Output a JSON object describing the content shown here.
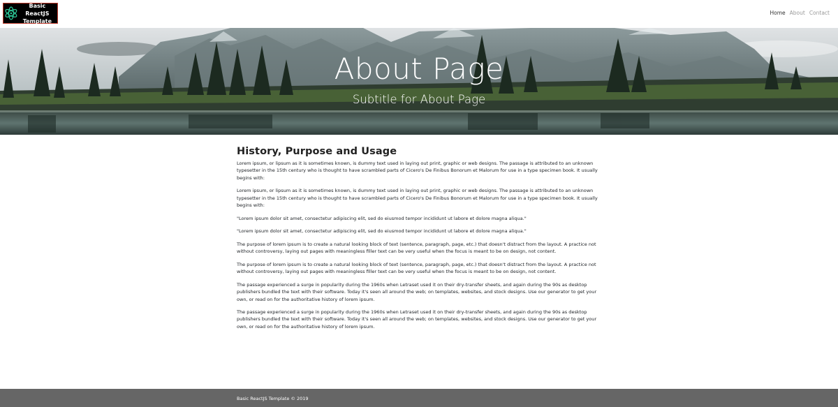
{
  "navbar": {
    "brand_text": "Basic ReactJS Template",
    "links": [
      {
        "label": "Home",
        "active": true
      },
      {
        "label": "About",
        "active": false
      },
      {
        "label": "Contact",
        "active": false
      }
    ]
  },
  "hero": {
    "title": "About Page",
    "subtitle": "Subtitle for About Page"
  },
  "content": {
    "heading": "History, Purpose and Usage",
    "paragraphs": [
      "Lorem ipsum, or lipsum as it is sometimes known, is dummy text used in laying out print, graphic or web designs. The passage is attributed to an unknown typesetter in the 15th century who is thought to have scrambled parts of Cicero's De Finibus Bonorum et Malorum for use in a type specimen book. It usually begins with:",
      "Lorem ipsum, or lipsum as it is sometimes known, is dummy text used in laying out print, graphic or web designs. The passage is attributed to an unknown typesetter in the 15th century who is thought to have scrambled parts of Cicero's De Finibus Bonorum et Malorum for use in a type specimen book. It usually begins with:",
      "\"Lorem ipsum dolor sit amet, consectetur adipiscing elit, sed do eiusmod tempor incididunt ut labore et dolore magna aliqua.\"",
      "\"Lorem ipsum dolor sit amet, consectetur adipiscing elit, sed do eiusmod tempor incididunt ut labore et dolore magna aliqua.\"",
      "The purpose of lorem ipsum is to create a natural looking block of text (sentence, paragraph, page, etc.) that doesn't distract from the layout. A practice not without controversy, laying out pages with meaningless filler text can be very useful when the focus is meant to be on design, not content.",
      "The purpose of lorem ipsum is to create a natural looking block of text (sentence, paragraph, page, etc.) that doesn't distract from the layout. A practice not without controversy, laying out pages with meaningless filler text can be very useful when the focus is meant to be on design, not content.",
      "The passage experienced a surge in popularity during the 1960s when Letraset used it on their dry-transfer sheets, and again during the 90s as desktop publishers bundled the text with their software. Today it's seen all around the web; on templates, websites, and stock designs. Use our generator to get your own, or read on for the authoritative history of lorem ipsum.",
      "The passage experienced a surge in popularity during the 1960s when Letraset used it on their dry-transfer sheets, and again during the 90s as desktop publishers bundled the text with their software. Today it's seen all around the web; on templates, websites, and stock designs. Use our generator to get your own, or read on for the authoritative history of lorem ipsum."
    ]
  },
  "footer": {
    "text": "Basic ReactJS Template © 2019"
  },
  "colors": {
    "footer_bg": "#666666",
    "brand_bg": "#000000",
    "logo_accent": "#2ecc9a"
  }
}
